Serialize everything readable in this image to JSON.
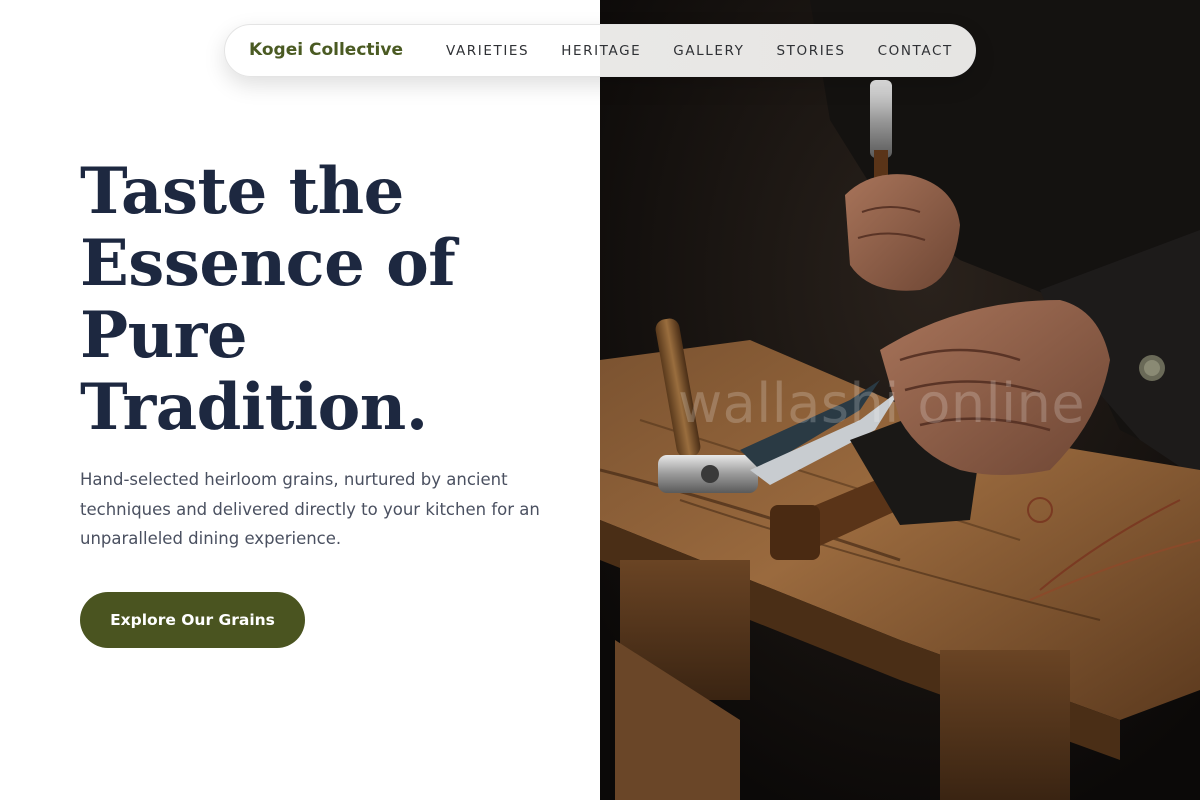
{
  "nav": {
    "brand": "Kogei Collective",
    "links": [
      "VARIETIES",
      "HERITAGE",
      "GALLERY",
      "STORIES",
      "CONTACT"
    ]
  },
  "hero": {
    "title_lines": [
      "Taste the",
      "Essence of",
      "Pure",
      "Tradition."
    ],
    "subtitle": "Hand-selected heirloom grains, nurtured by ancient techniques and delivered directly to your kitchen for an unparalleled dining experience.",
    "cta_label": "Explore Our Grains"
  },
  "image": {
    "watermark": "wallashi online",
    "subject": "craftsman-hands-with-tools-on-wooden-bench"
  },
  "colors": {
    "brand_green": "#4a5a22",
    "button_green": "#4a5420",
    "title_navy": "#1d2840",
    "body_gray": "#4a5060"
  }
}
